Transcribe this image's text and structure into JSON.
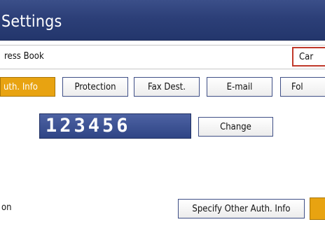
{
  "window": {
    "title": "Settings"
  },
  "address_row": {
    "label": "ress Book",
    "cancel_label": "Car"
  },
  "tabs": [
    {
      "label": "uth. Info",
      "active": true
    },
    {
      "label": "Protection",
      "active": false
    },
    {
      "label": "Fax Dest.",
      "active": false
    },
    {
      "label": "E-mail",
      "active": false
    },
    {
      "label": "Fol",
      "active": false
    }
  ],
  "auth": {
    "number": "123456",
    "change_label": "Change"
  },
  "bottom": {
    "label": "on",
    "specify_label": "Specify Other Auth. Info"
  },
  "colors": {
    "titlebar": "#2c3f78",
    "accent": "#e8a311",
    "cancel_border": "#c0392b"
  }
}
